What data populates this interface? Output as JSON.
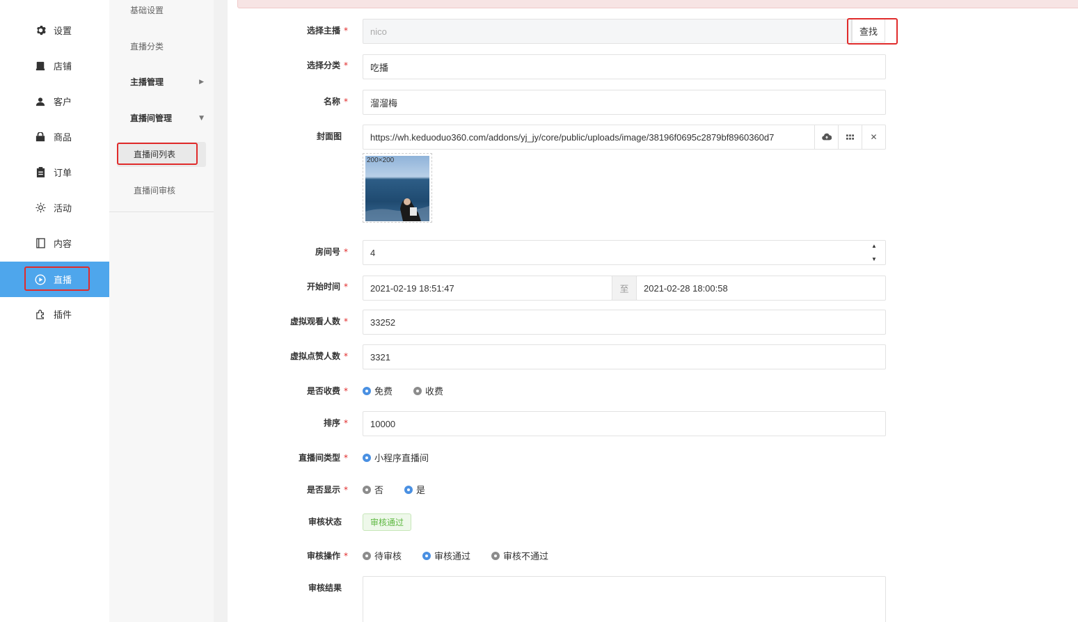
{
  "sidebar": {
    "items": [
      {
        "label": "设置",
        "icon": "gear-icon"
      },
      {
        "label": "店铺",
        "icon": "store-icon"
      },
      {
        "label": "客户",
        "icon": "user-icon"
      },
      {
        "label": "商品",
        "icon": "shopping-bag-icon"
      },
      {
        "label": "订单",
        "icon": "clipboard-icon"
      },
      {
        "label": "活动",
        "icon": "sun-icon"
      },
      {
        "label": "内容",
        "icon": "book-icon"
      },
      {
        "label": "直播",
        "icon": "play-circle-icon"
      },
      {
        "label": "插件",
        "icon": "puzzle-icon"
      }
    ],
    "active": "直播"
  },
  "subsidebar": {
    "items": [
      {
        "label": "基础设置"
      },
      {
        "label": "直播分类"
      },
      {
        "label": "主播管理"
      },
      {
        "label": "直播间管理"
      },
      {
        "label": "直播间列表"
      },
      {
        "label": "直播间审核"
      }
    ],
    "active": "直播间列表"
  },
  "form": {
    "anchor": {
      "label": "选择主播",
      "placeholder": "nico",
      "button": "查找"
    },
    "category": {
      "label": "选择分类",
      "value": "吃播"
    },
    "name": {
      "label": "名称",
      "value": "溜溜梅"
    },
    "cover": {
      "label": "封面图",
      "value": "https://wh.keduoduo360.com/addons/yj_jy/core/public/uploads/image/38196f0695c2879bf8960360d7",
      "thumb_size": "200×200"
    },
    "room_no": {
      "label": "房间号",
      "value": "4"
    },
    "start_time": {
      "label": "开始时间",
      "from": "2021-02-19 18:51:47",
      "separator": "至",
      "to": "2021-02-28 18:00:58"
    },
    "virtual_viewers": {
      "label": "虚拟观看人数",
      "value": "33252"
    },
    "virtual_likes": {
      "label": "虚拟点赞人数",
      "value": "3321"
    },
    "charge": {
      "label": "是否收费",
      "options": [
        "免费",
        "收费"
      ],
      "selected": "免费"
    },
    "sort": {
      "label": "排序",
      "value": "10000"
    },
    "room_type": {
      "label": "直播间类型",
      "options": [
        "小程序直播间"
      ],
      "selected": "小程序直播间"
    },
    "display": {
      "label": "是否显示",
      "options": [
        "否",
        "是"
      ],
      "selected": "是"
    },
    "review_status": {
      "label": "审核状态",
      "value": "审核通过"
    },
    "review_action": {
      "label": "审核操作",
      "options": [
        "待审核",
        "审核通过",
        "审核不通过"
      ],
      "selected": "审核通过"
    },
    "review_result": {
      "label": "审核结果"
    }
  },
  "colors": {
    "accent": "#4ea6ec",
    "radio_on": "#4a90e2",
    "required": "#e02b2b",
    "success": "#5fb842"
  }
}
